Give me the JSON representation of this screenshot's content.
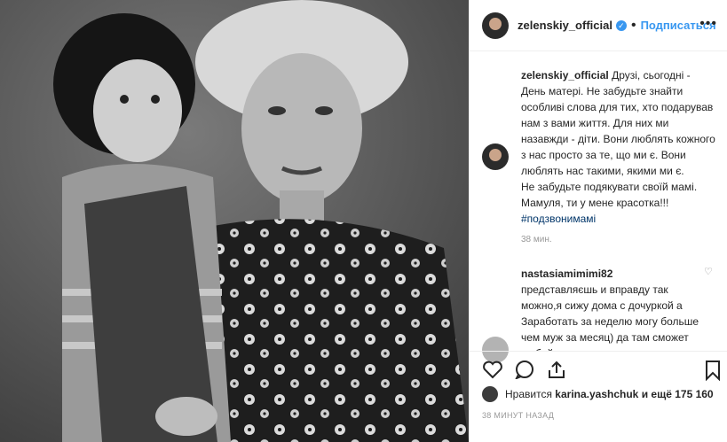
{
  "post": {
    "username": "zelenskiy_official",
    "follow_label": "Подписаться",
    "caption_lines": [
      "Друзі, сьогодні - День матері. Не забудьте знайти особливі слова для тих, хто подарував нам з вами життя. Для них ми назавжди - діти. Вони люблять кожного з нас просто за те, що ми є. Вони люблять нас такими, якими ми є.",
      "Не забудьте подякувати своїй мамі. Мамуля, ти у мене красотка!!!"
    ],
    "hashtag": "#подзвонимамі",
    "caption_time": "38 мин."
  },
  "comment": {
    "username": "nastasiamimimi82",
    "text": "представляєшь и вправду так можно,я сижу дома с дочуркой а Заработать за неделю могу больше чем муж за месяц) да там сможет любой даже со"
  },
  "likes": {
    "prefix": "Нравится",
    "user": "karina.yashchuk",
    "suffix": "и ещё 175 160"
  },
  "timestamp": "38 МИНУТ НАЗАД",
  "icons": [
    "heart-icon",
    "comment-icon",
    "share-icon",
    "bookmark-icon",
    "more-icon",
    "verified-icon"
  ],
  "colors": {
    "accent": "#3897f0",
    "text": "#262626",
    "muted": "#999999"
  }
}
